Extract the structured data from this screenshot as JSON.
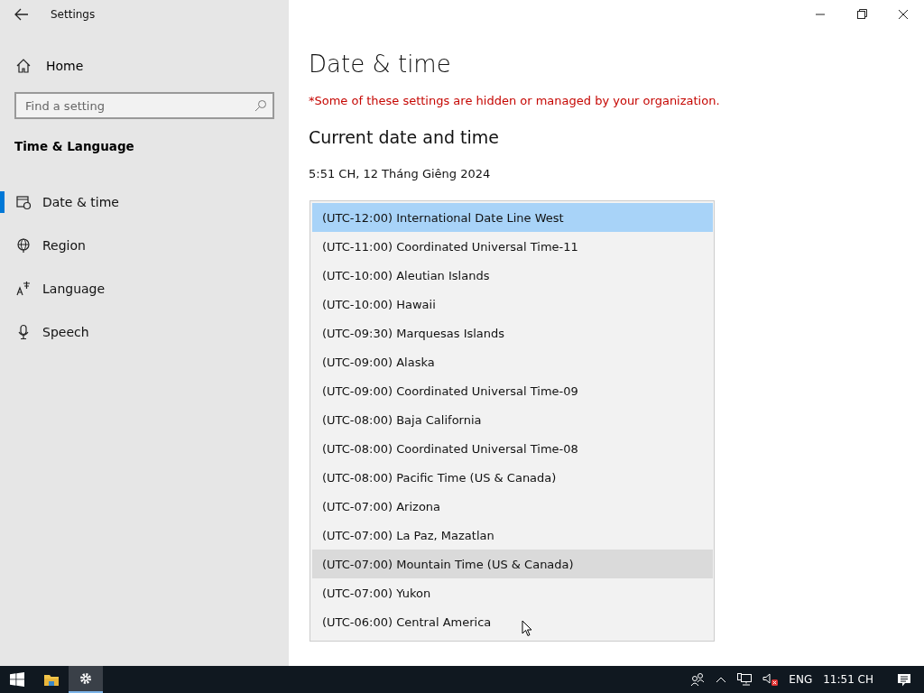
{
  "window": {
    "title": "Settings"
  },
  "sidebar": {
    "home": "Home",
    "search": {
      "placeholder": "Find a setting"
    },
    "section": "Time & Language",
    "items": [
      {
        "label": "Date & time",
        "selected": true
      },
      {
        "label": "Region",
        "selected": false
      },
      {
        "label": "Language",
        "selected": false
      },
      {
        "label": "Speech",
        "selected": false
      }
    ]
  },
  "main": {
    "title": "Date & time",
    "notice": "*Some of these settings are hidden or managed by your organization.",
    "heading": "Current date and time",
    "current": "5:51 CH, 12 Tháng Giêng 2024"
  },
  "timezone_list": [
    {
      "label": "(UTC-12:00) International Date Line West",
      "selected": true,
      "hovered": false
    },
    {
      "label": "(UTC-11:00) Coordinated Universal Time-11",
      "selected": false,
      "hovered": false
    },
    {
      "label": "(UTC-10:00) Aleutian Islands",
      "selected": false,
      "hovered": false
    },
    {
      "label": "(UTC-10:00) Hawaii",
      "selected": false,
      "hovered": false
    },
    {
      "label": "(UTC-09:30) Marquesas Islands",
      "selected": false,
      "hovered": false
    },
    {
      "label": "(UTC-09:00) Alaska",
      "selected": false,
      "hovered": false
    },
    {
      "label": "(UTC-09:00) Coordinated Universal Time-09",
      "selected": false,
      "hovered": false
    },
    {
      "label": "(UTC-08:00) Baja California",
      "selected": false,
      "hovered": false
    },
    {
      "label": "(UTC-08:00) Coordinated Universal Time-08",
      "selected": false,
      "hovered": false
    },
    {
      "label": "(UTC-08:00) Pacific Time (US & Canada)",
      "selected": false,
      "hovered": false
    },
    {
      "label": "(UTC-07:00) Arizona",
      "selected": false,
      "hovered": false
    },
    {
      "label": "(UTC-07:00) La Paz, Mazatlan",
      "selected": false,
      "hovered": false
    },
    {
      "label": "(UTC-07:00) Mountain Time (US & Canada)",
      "selected": false,
      "hovered": true
    },
    {
      "label": "(UTC-07:00) Yukon",
      "selected": false,
      "hovered": false
    },
    {
      "label": "(UTC-06:00) Central America",
      "selected": false,
      "hovered": false
    }
  ],
  "taskbar": {
    "language": "ENG",
    "clock": "11:51 CH"
  }
}
